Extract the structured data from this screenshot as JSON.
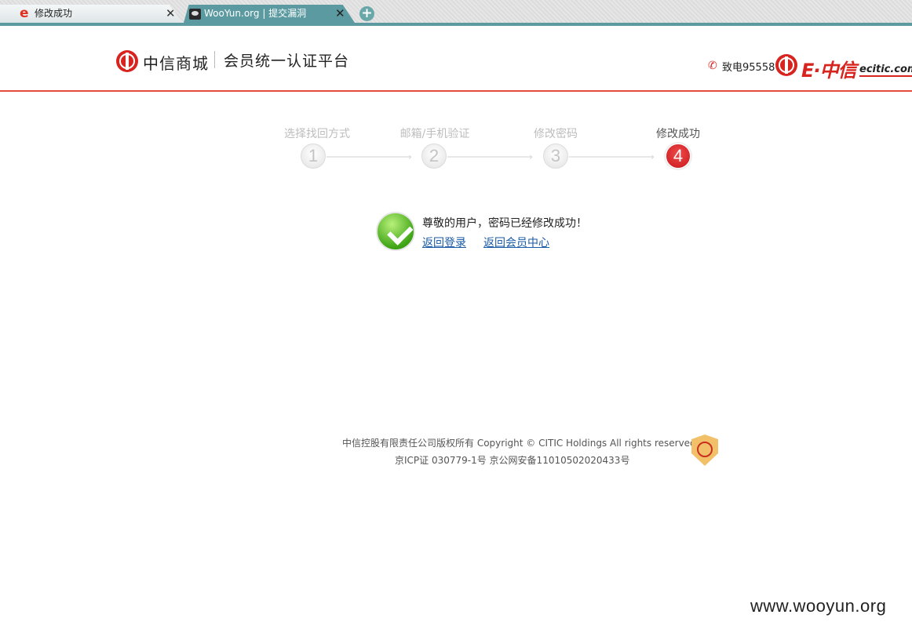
{
  "browser": {
    "tabs": [
      {
        "title": "修改成功",
        "icon": "ie-e-icon",
        "close": "✕",
        "active": false
      },
      {
        "title": "WooYun.org | 提交漏洞",
        "icon": "wooyun-icon",
        "close": "✕",
        "active": true
      }
    ],
    "new_tab": "+"
  },
  "header": {
    "brand": "中信商城",
    "platform": "会员统一认证平台",
    "phone_label": "致电95558",
    "partner_mark": "E·中信",
    "partner_url": "ecitic.com",
    "accent_color": "#d8241e"
  },
  "steps": [
    {
      "label": "选择找回方式",
      "number": "1",
      "active": false
    },
    {
      "label": "邮箱/手机验证",
      "number": "2",
      "active": false
    },
    {
      "label": "修改密码",
      "number": "3",
      "active": false
    },
    {
      "label": "修改成功",
      "number": "4",
      "active": true
    }
  ],
  "result": {
    "message": "尊敬的用户，密码已经修改成功！",
    "links": {
      "back_login": "返回登录",
      "back_member": "返回会员中心"
    }
  },
  "footer": {
    "line1": "中信控股有限责任公司版权所有  Copyright © CITIC Holdings All rights reserved",
    "line2": "京ICP证  030779-1号  京公网安备11010502020433号"
  },
  "watermark": "www.wooyun.org"
}
